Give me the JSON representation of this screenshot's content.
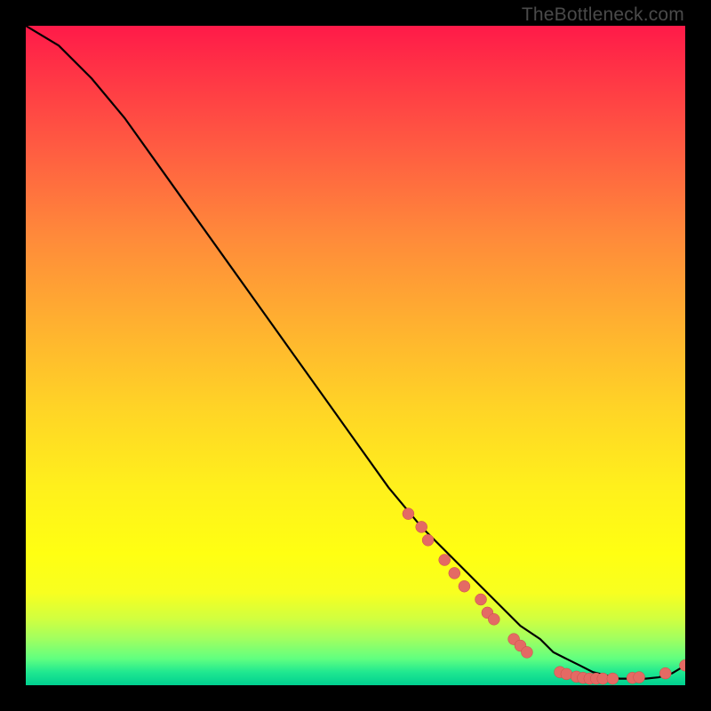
{
  "attribution": "TheBottleneck.com",
  "colors": {
    "curve": "#000000",
    "point_fill": "#e46a64",
    "point_stroke": "#c94e48"
  },
  "chart_data": {
    "type": "line",
    "title": "",
    "xlabel": "",
    "ylabel": "",
    "xlim": [
      0,
      100
    ],
    "ylim": [
      0,
      100
    ],
    "series": [
      {
        "name": "bottleneck-curve",
        "x": [
          0,
          5,
          10,
          15,
          20,
          25,
          30,
          35,
          40,
          45,
          50,
          55,
          60,
          65,
          70,
          75,
          78,
          80,
          82,
          84,
          86,
          88,
          90,
          92,
          94,
          96,
          98,
          100
        ],
        "y": [
          100,
          97,
          92,
          86,
          79,
          72,
          65,
          58,
          51,
          44,
          37,
          30,
          24,
          19,
          14,
          9,
          7,
          5,
          4,
          3,
          2,
          1.5,
          1,
          1,
          1,
          1.2,
          1.8,
          3
        ]
      }
    ],
    "points": [
      {
        "x": 58,
        "y": 26
      },
      {
        "x": 60,
        "y": 24
      },
      {
        "x": 61,
        "y": 22
      },
      {
        "x": 63.5,
        "y": 19
      },
      {
        "x": 65,
        "y": 17
      },
      {
        "x": 66.5,
        "y": 15
      },
      {
        "x": 69,
        "y": 13
      },
      {
        "x": 70,
        "y": 11
      },
      {
        "x": 71,
        "y": 10
      },
      {
        "x": 74,
        "y": 7
      },
      {
        "x": 75,
        "y": 6
      },
      {
        "x": 76,
        "y": 5
      },
      {
        "x": 81,
        "y": 2
      },
      {
        "x": 82,
        "y": 1.7
      },
      {
        "x": 83.5,
        "y": 1.3
      },
      {
        "x": 84.5,
        "y": 1.1
      },
      {
        "x": 85.5,
        "y": 1
      },
      {
        "x": 86.5,
        "y": 1
      },
      {
        "x": 87.5,
        "y": 1
      },
      {
        "x": 89,
        "y": 1
      },
      {
        "x": 92,
        "y": 1.1
      },
      {
        "x": 93,
        "y": 1.2
      },
      {
        "x": 97,
        "y": 1.8
      },
      {
        "x": 100,
        "y": 3
      }
    ]
  }
}
